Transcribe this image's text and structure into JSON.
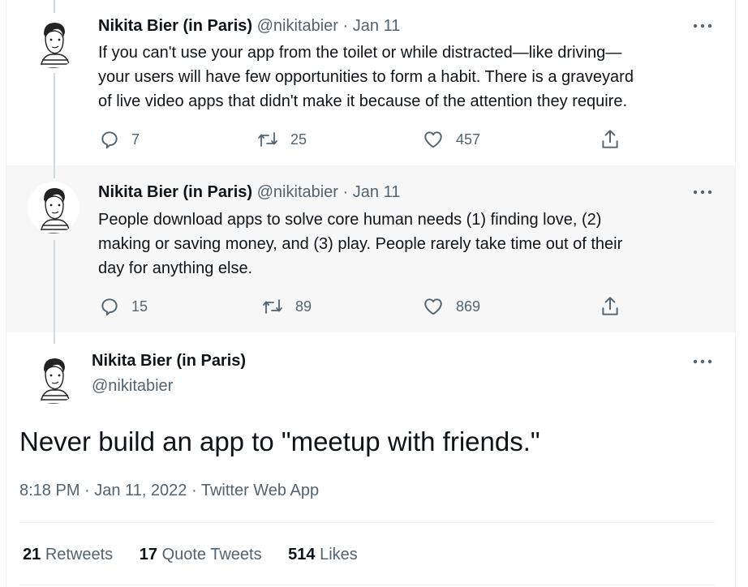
{
  "thread": [
    {
      "author_name": "Nikita Bier (in Paris)",
      "handle": "@nikitabier",
      "separator": "·",
      "date": "Jan 11",
      "text_lines": [
        "If you can't use your app from the toilet or while distracted—like driving—",
        "your users will have few opportunities to form a habit. There is a graveyard",
        "of live video apps that didn't make it because of the attention they require."
      ],
      "replies": "7",
      "retweets": "25",
      "likes": "457"
    },
    {
      "author_name": "Nikita Bier (in Paris)",
      "handle": "@nikitabier",
      "separator": "·",
      "date": "Jan 11",
      "text_lines": [
        "People download apps to solve core human needs (1) finding love, (2)",
        "making or saving money, and (3) play. People rarely take time out of their",
        "day for anything else."
      ],
      "replies": "15",
      "retweets": "89",
      "likes": "869"
    }
  ],
  "main_tweet": {
    "author_name": "Nikita Bier (in Paris)",
    "handle": "@nikitabier",
    "text": "Never build an app to \"meetup with friends.\"",
    "meta": "8:18 PM · Jan 11, 2022 · Twitter Web App",
    "stats": {
      "retweets_count": "21",
      "retweets_label": "Retweets",
      "quote_count": "17",
      "quote_label": "Quote Tweets",
      "likes_count": "514",
      "likes_label": "Likes"
    }
  },
  "icons": {
    "reply": "reply-icon",
    "retweet": "retweet-icon",
    "like": "heart-icon",
    "share": "share-icon",
    "more": "more-icon"
  },
  "colors": {
    "text": "#0f1419",
    "muted": "#536471",
    "highlight_bg": "#f7f7f7",
    "thread_line": "#cfd9de"
  }
}
